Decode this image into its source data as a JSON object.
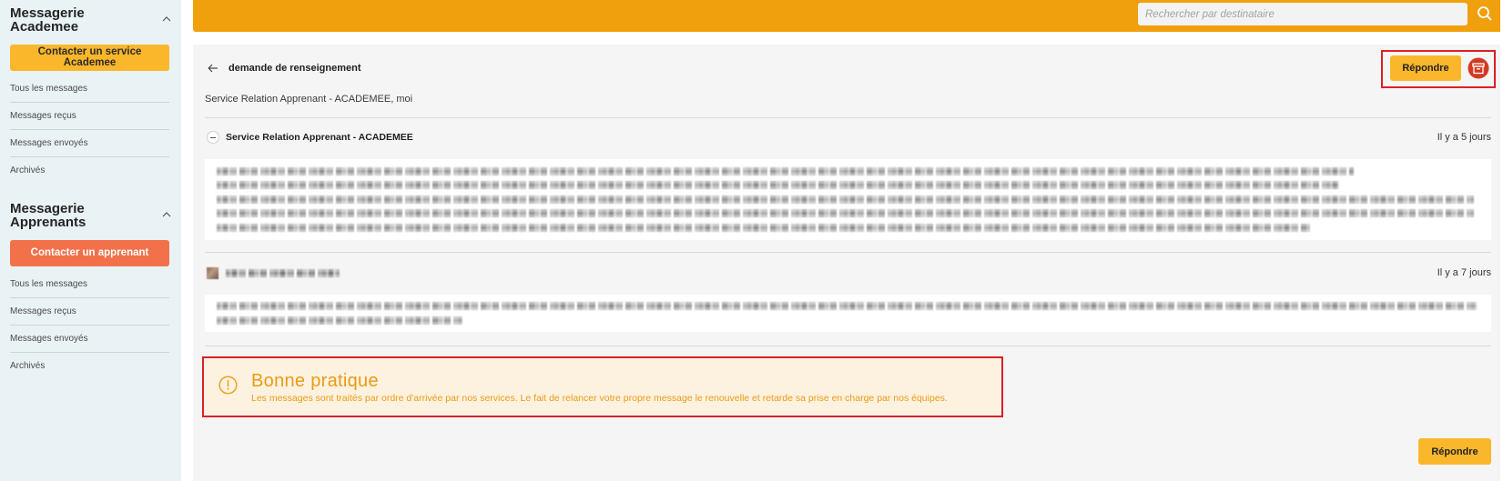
{
  "sidebar": {
    "sections": [
      {
        "title": "Messagerie Academee",
        "collapse_icon": "chevron-up-icon",
        "contact_button": "Contacter un service Academee",
        "items": [
          "Tous les messages",
          "Messages reçus",
          "Messages envoyés",
          "Archivés"
        ]
      },
      {
        "title": "Messagerie Apprenants",
        "collapse_icon": "chevron-up-icon",
        "contact_button": "Contacter un apprenant",
        "items": [
          "Tous les messages",
          "Messages reçus",
          "Messages envoyés",
          "Archivés"
        ]
      }
    ]
  },
  "header": {
    "search": {
      "placeholder": "Rechercher par destinataire",
      "value": "",
      "icon": "search-icon"
    }
  },
  "thread": {
    "back_icon": "arrow-left-icon",
    "subject": "demande de renseignement",
    "participants": "Service Relation Apprenant - ACADEMEE, moi",
    "reply_label": "Répondre",
    "archive_icon": "archive-icon",
    "messages": [
      {
        "sender": "Service Relation Apprenant - ACADEMEE",
        "time": "Il y a 5 jours"
      },
      {
        "time": "Il y a 7 jours"
      }
    ],
    "tip": {
      "icon": "alert-circle-icon",
      "title": "Bonne pratique",
      "text": "Les messages sont traités par ordre d'arrivée par nos services. Le fait de relancer votre propre message le renouvelle et retarde sa prise en charge par nos équipes."
    },
    "bottom_reply_label": "Répondre"
  },
  "colors": {
    "top_bar": "#f0a00c",
    "sidebar_bg": "#e9f2f5",
    "primary_button": "#fbb72c",
    "secondary_button": "#f2714b",
    "archive_button": "#d33a22",
    "tip_bg": "#fdf2df",
    "tip_text": "#ec9a15",
    "annotation": "#dc1f26"
  }
}
